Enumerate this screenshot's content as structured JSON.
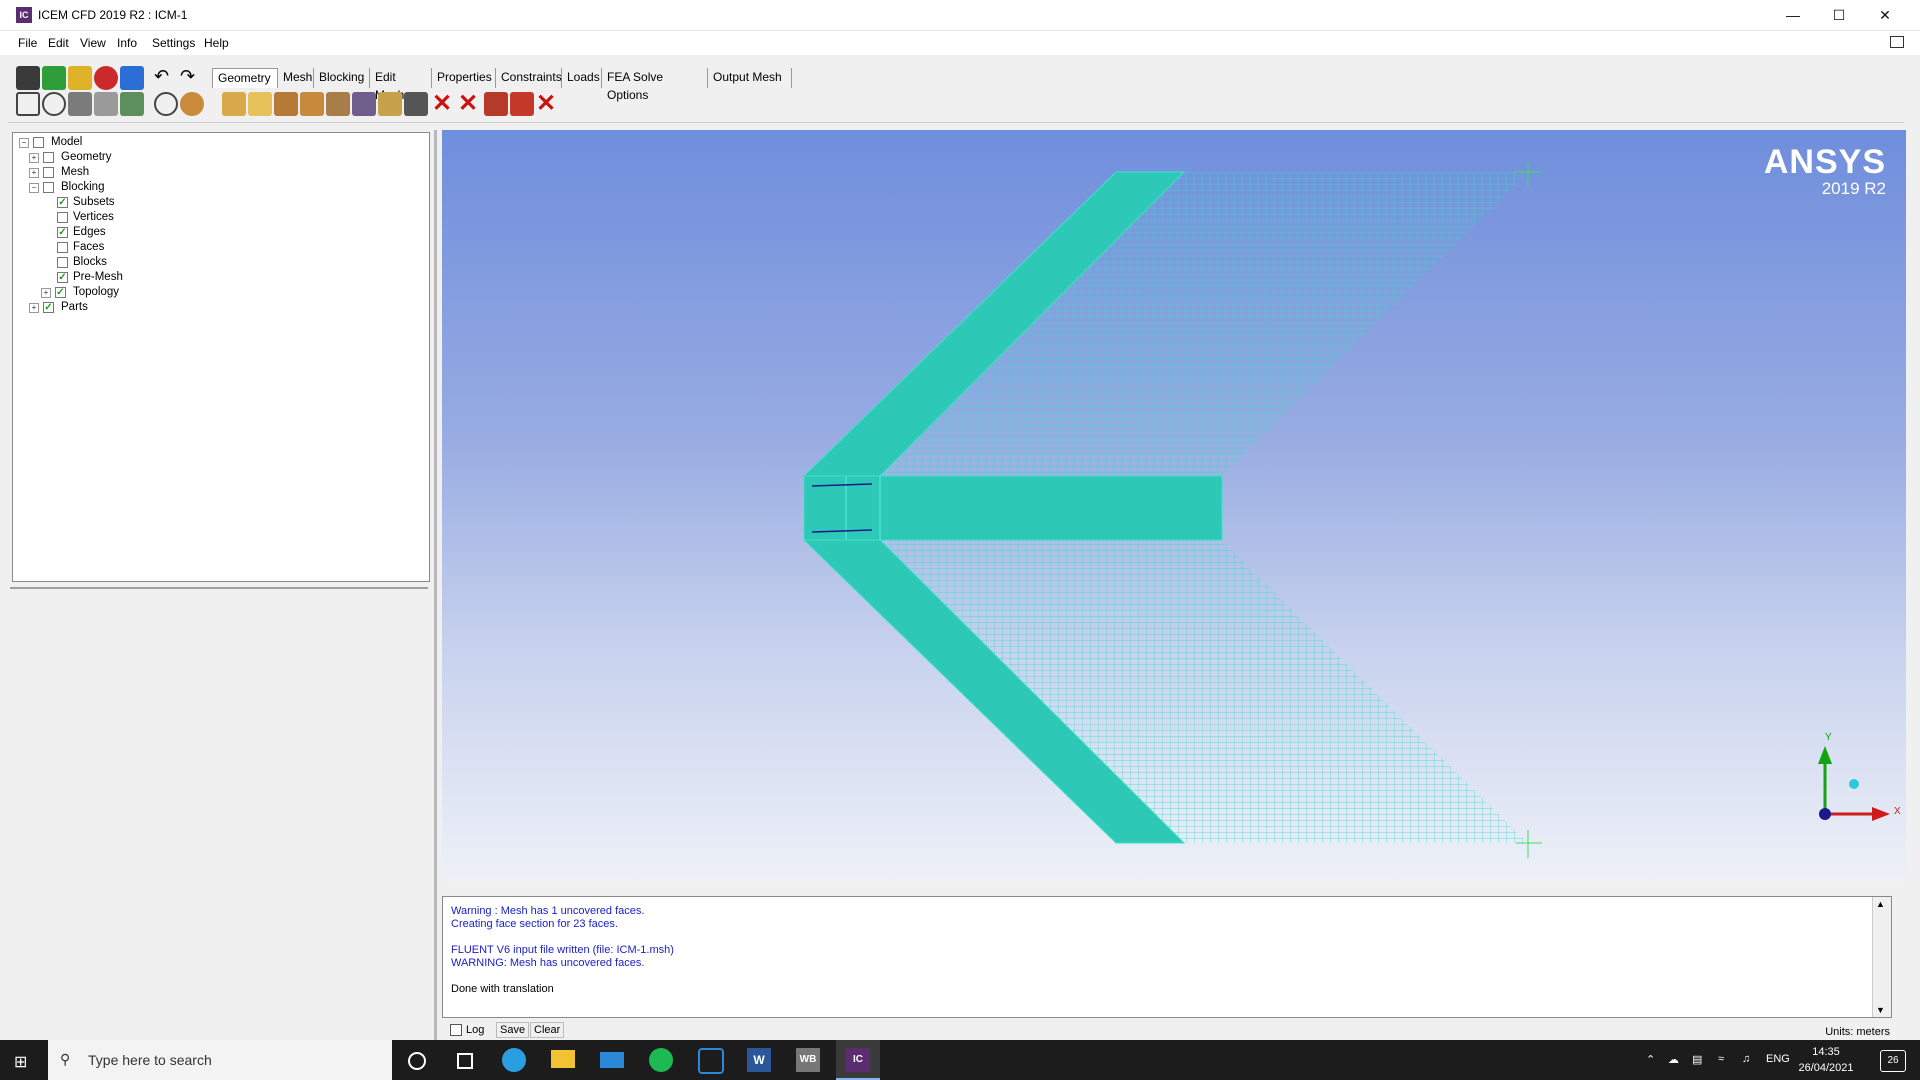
{
  "window": {
    "title": "ICEM CFD 2019 R2 : ICM-1",
    "icon_text": "IC"
  },
  "menu": [
    "File",
    "Edit",
    "View",
    "Info",
    "Settings",
    "Help"
  ],
  "tabs": [
    {
      "label": "Geometry",
      "active": true
    },
    {
      "label": "Mesh"
    },
    {
      "label": "Blocking"
    },
    {
      "label": "Edit Mesh"
    },
    {
      "label": "Properties"
    },
    {
      "label": "Constraints"
    },
    {
      "label": "Loads"
    },
    {
      "label": "FEA Solve Options"
    },
    {
      "label": "Output Mesh"
    }
  ],
  "tree": [
    {
      "label": "Model",
      "level": 0,
      "expander": "-",
      "checked": "partial"
    },
    {
      "label": "Geometry",
      "level": 1,
      "expander": "+",
      "checked": "partial"
    },
    {
      "label": "Mesh",
      "level": 1,
      "expander": "+",
      "checked": "partial"
    },
    {
      "label": "Blocking",
      "level": 1,
      "expander": "-",
      "checked": "partial"
    },
    {
      "label": "Subsets",
      "level": 2,
      "checked": "yes"
    },
    {
      "label": "Vertices",
      "level": 2,
      "checked": "no"
    },
    {
      "label": "Edges",
      "level": 2,
      "checked": "yes"
    },
    {
      "label": "Faces",
      "level": 2,
      "checked": "no"
    },
    {
      "label": "Blocks",
      "level": 2,
      "checked": "no"
    },
    {
      "label": "Pre-Mesh",
      "level": 2,
      "checked": "yes"
    },
    {
      "label": "Topology",
      "level": 2,
      "expander": "+",
      "checked": "yes"
    },
    {
      "label": "Parts",
      "level": 1,
      "expander": "+",
      "checked": "yes"
    }
  ],
  "viewport": {
    "brand": "ANSYS",
    "version": "2019 R2",
    "axis_y": "Y",
    "axis_x": "X",
    "colors": {
      "mesh": "#2ec9b6",
      "mesh_line": "#3bd8c6",
      "axis_x": "#d11a1a",
      "axis_y": "#15a315",
      "axis_origin": "#1a1a8c"
    }
  },
  "messages": [
    "Warning : Mesh has 1 uncovered faces.",
    "Creating face section for 23 faces.",
    "",
    "FLUENT V6 input file written (file: ICM-1.msh)",
    "WARNING: Mesh has uncovered faces.",
    "",
    "Done with translation"
  ],
  "message_controls": {
    "log": "Log",
    "save": "Save",
    "clear": "Clear"
  },
  "units": "Units: meters",
  "taskbar": {
    "search_placeholder": "Type here to search",
    "language": "ENG",
    "time": "14:35",
    "date": "26/04/2021",
    "notifications": "26"
  }
}
